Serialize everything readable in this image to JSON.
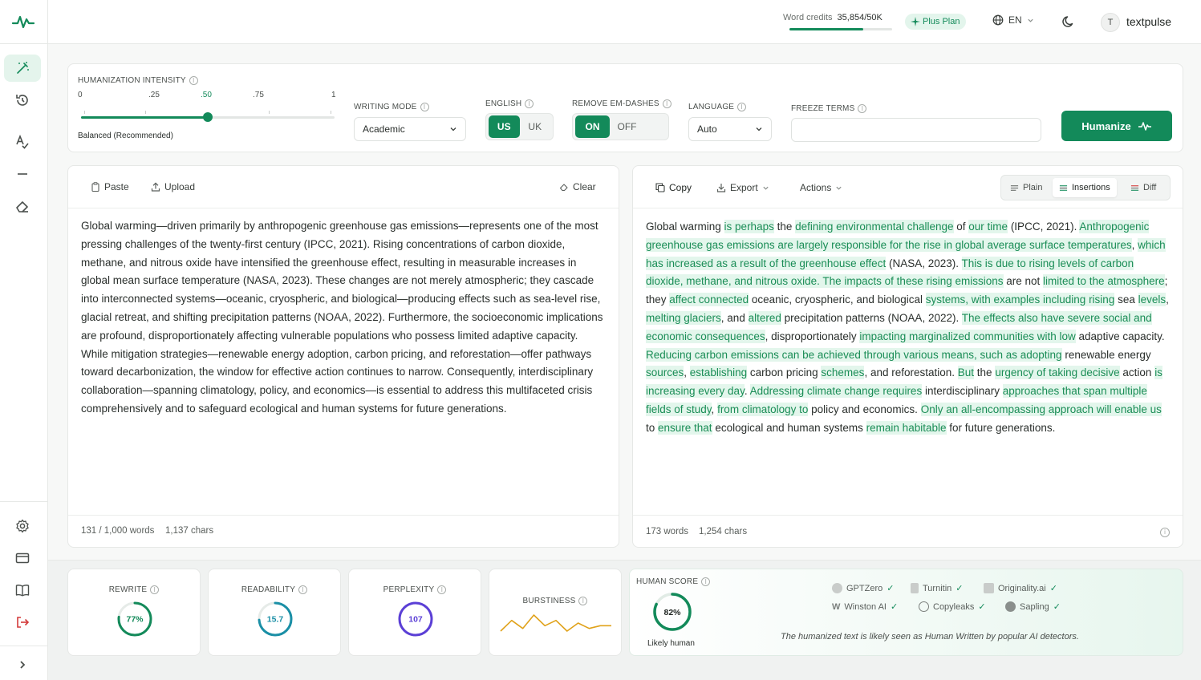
{
  "header": {
    "credits_label": "Word credits",
    "credits_value": "35,854/50K",
    "credits_fraction": 0.717,
    "plan": "Plus Plan",
    "language": "EN",
    "avatar_initial": "T",
    "username": "textpulse"
  },
  "settings": {
    "intensity_label": "HUMANIZATION INTENSITY",
    "ticks": [
      "0",
      ".25",
      ".50",
      ".75",
      "1"
    ],
    "intensity_value": 0.5,
    "intensity_caption": "Balanced (Recommended)",
    "writing_mode_label": "WRITING MODE",
    "writing_mode": "Academic",
    "english_label": "ENGLISH",
    "english_options": [
      "US",
      "UK"
    ],
    "english_selected": "US",
    "emdash_label": "REMOVE EM-DASHES",
    "emdash_options": [
      "ON",
      "OFF"
    ],
    "emdash_selected": "ON",
    "language_label": "LANGUAGE",
    "language_value": "Auto",
    "freeze_label": "FREEZE TERMS",
    "freeze_value": "",
    "humanize_label": "Humanize"
  },
  "input_panel": {
    "paste_label": "Paste",
    "upload_label": "Upload",
    "clear_label": "Clear",
    "text": "Global warming—driven primarily by anthropogenic greenhouse gas emissions—represents one of the most pressing challenges of the twenty-first century (IPCC, 2021). Rising concentrations of carbon dioxide, methane, and nitrous oxide have intensified the greenhouse effect, resulting in measurable increases in global mean surface temperature (NASA, 2023). These changes are not merely atmospheric; they cascade into interconnected systems—oceanic, cryospheric, and biological—producing effects such as sea-level rise, glacial retreat, and shifting precipitation patterns (NOAA, 2022). Furthermore, the socioeconomic implications are profound, disproportionately affecting vulnerable populations who possess limited adaptive capacity. While mitigation strategies—renewable energy adoption, carbon pricing, and reforestation—offer pathways toward decarbonization, the window for effective action continues to narrow. Consequently, interdisciplinary collaboration—spanning climatology, policy, and economics—is essential to address this multifaceted crisis comprehensively and to safeguard ecological and human systems for future generations.",
    "word_count": "131 / 1,000 words",
    "char_count": "1,137 chars"
  },
  "output_panel": {
    "copy_label": "Copy",
    "export_label": "Export",
    "actions_label": "Actions",
    "view_options": [
      "Plain",
      "Insertions",
      "Diff"
    ],
    "view_selected": "Insertions",
    "segments": [
      [
        "Global warming ",
        false
      ],
      [
        "is perhaps",
        true
      ],
      [
        " the ",
        false
      ],
      [
        "defining environmental challenge",
        true
      ],
      [
        " of ",
        false
      ],
      [
        "our time",
        true
      ],
      [
        " (IPCC, 2021). ",
        false
      ],
      [
        "Anthropogenic greenhouse gas emissions are largely responsible for the rise in global average surface temperatures",
        true
      ],
      [
        ", ",
        false
      ],
      [
        "which has increased as a result of the greenhouse effect",
        true
      ],
      [
        " (NASA, 2023). ",
        false
      ],
      [
        "This is due to rising levels of carbon dioxide, methane, and nitrous oxide. The impacts of these rising emissions",
        true
      ],
      [
        " are not ",
        false
      ],
      [
        "limited to the atmosphere",
        true
      ],
      [
        "; they ",
        false
      ],
      [
        "affect connected",
        true
      ],
      [
        " oceanic, cryospheric, and biological ",
        false
      ],
      [
        "systems, with examples including rising",
        true
      ],
      [
        " sea ",
        false
      ],
      [
        "levels",
        true
      ],
      [
        ", ",
        false
      ],
      [
        "melting glaciers",
        true
      ],
      [
        ", and ",
        false
      ],
      [
        "altered",
        true
      ],
      [
        " precipitation patterns (NOAA, 2022). ",
        false
      ],
      [
        "The effects also have severe social and economic consequences",
        true
      ],
      [
        ", disproportionately ",
        false
      ],
      [
        "impacting marginalized communities with low",
        true
      ],
      [
        " adaptive capacity. ",
        false
      ],
      [
        "Reducing carbon emissions can be achieved through various means, such as adopting",
        true
      ],
      [
        " renewable energy ",
        false
      ],
      [
        "sources",
        true
      ],
      [
        ", ",
        false
      ],
      [
        "establishing",
        true
      ],
      [
        " carbon pricing ",
        false
      ],
      [
        "schemes",
        true
      ],
      [
        ", and reforestation. ",
        false
      ],
      [
        "But",
        true
      ],
      [
        " the ",
        false
      ],
      [
        "urgency of taking decisive",
        true
      ],
      [
        " action ",
        false
      ],
      [
        "is increasing every day",
        true
      ],
      [
        ". ",
        false
      ],
      [
        "Addressing climate change requires",
        true
      ],
      [
        " interdisciplinary ",
        false
      ],
      [
        "approaches that span multiple fields of study",
        true
      ],
      [
        ", ",
        false
      ],
      [
        "from climatology to",
        true
      ],
      [
        " policy and economics. ",
        false
      ],
      [
        "Only an all-encompassing approach will enable us",
        true
      ],
      [
        " to ",
        false
      ],
      [
        "ensure that",
        true
      ],
      [
        " ecological and human systems ",
        false
      ],
      [
        "remain habitable",
        true
      ],
      [
        " for future generations.",
        false
      ]
    ],
    "word_count": "173 words",
    "char_count": "1,254 chars"
  },
  "metrics": {
    "rewrite": {
      "label": "REWRITE",
      "value": "77%",
      "fraction": 0.77,
      "color": "#138a5a"
    },
    "readability": {
      "label": "READABILITY",
      "value": "15.7",
      "fraction": 0.74,
      "color": "#1a8fa6"
    },
    "perplexity": {
      "label": "PERPLEXITY",
      "value": "107",
      "fraction": 1.0,
      "color": "#5b3fd6"
    },
    "burstiness": {
      "label": "BURSTINESS",
      "series": [
        3,
        7,
        4,
        9,
        5,
        7,
        3,
        6,
        4,
        5,
        5
      ],
      "color": "#e0a21a"
    }
  },
  "human_score": {
    "label": "HUMAN SCORE",
    "value": "82%",
    "fraction": 0.82,
    "caption": "Likely human",
    "detectors": [
      "GPTZero",
      "Turnitin",
      "Originality.ai",
      "Winston AI",
      "Copyleaks",
      "Sapling"
    ],
    "note": "The humanized text is likely seen as Human Written by popular AI detectors."
  },
  "colors": {
    "accent": "#138a5a",
    "highlight_bg": "#e3f6ec",
    "highlight_text": "#1a8d56"
  }
}
